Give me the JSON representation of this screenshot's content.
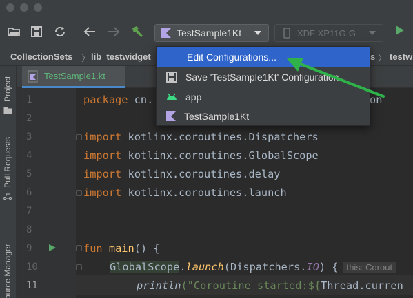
{
  "window": {
    "traffic_lights": [
      "close",
      "minimize",
      "zoom"
    ]
  },
  "toolbar": {
    "buttons": [
      "open-folder-icon",
      "save-icon",
      "sync-icon",
      "back-icon",
      "forward-icon",
      "build-hammer-icon"
    ],
    "run_configuration": "TestSample1Kt",
    "device": "XDF XP11G-G",
    "run_icon": "run-icon"
  },
  "navbar": {
    "crumbs": [
      "CollectionSets",
      "lib_testwidget",
      "s",
      "testw"
    ]
  },
  "side_tabs": {
    "project": "Project",
    "pull_requests": "Pull Requests",
    "resource_manager": "ource Manager"
  },
  "editor_tab": {
    "label": "TestSample1.kt"
  },
  "run_config_menu": {
    "items": [
      {
        "label": "Edit Configurations...",
        "selected": true,
        "icon": ""
      },
      {
        "label": "Save 'TestSample1Kt' Configuration",
        "selected": false,
        "icon": "save-icon"
      },
      {
        "label": "app",
        "selected": false,
        "icon": "android-icon"
      },
      {
        "label": "TestSample1Kt",
        "selected": false,
        "icon": "kotlin-icon"
      }
    ]
  },
  "code": {
    "line_numbers": [
      "1",
      "2",
      "3",
      "4",
      "5",
      "6",
      "7",
      "8",
      "9",
      "10",
      "11"
    ],
    "line1_keyword": "package",
    "line1_rest": " cn.",
    "line1_tail": "on",
    "imports": [
      "kotlinx.coroutines.Dispatchers",
      "kotlinx.coroutines.GlobalScope",
      "kotlinx.coroutines.delay",
      "kotlinx.coroutines.launch"
    ],
    "import_keyword": "import",
    "line9_keyword": "fun",
    "line9_name": "main",
    "line9_rest": "() {",
    "line10_scope": "GlobalScope",
    "line10_dot": ".",
    "line10_launch": "launch",
    "line10_rest": "(Dispatchers.",
    "line10_io": "IO",
    "line10_end": ") {",
    "line10_hint": "this: Corout",
    "line11_fn": "println",
    "line11_str": "(\"Coroutine started:${",
    "line11_rest": "Thread.curren"
  }
}
